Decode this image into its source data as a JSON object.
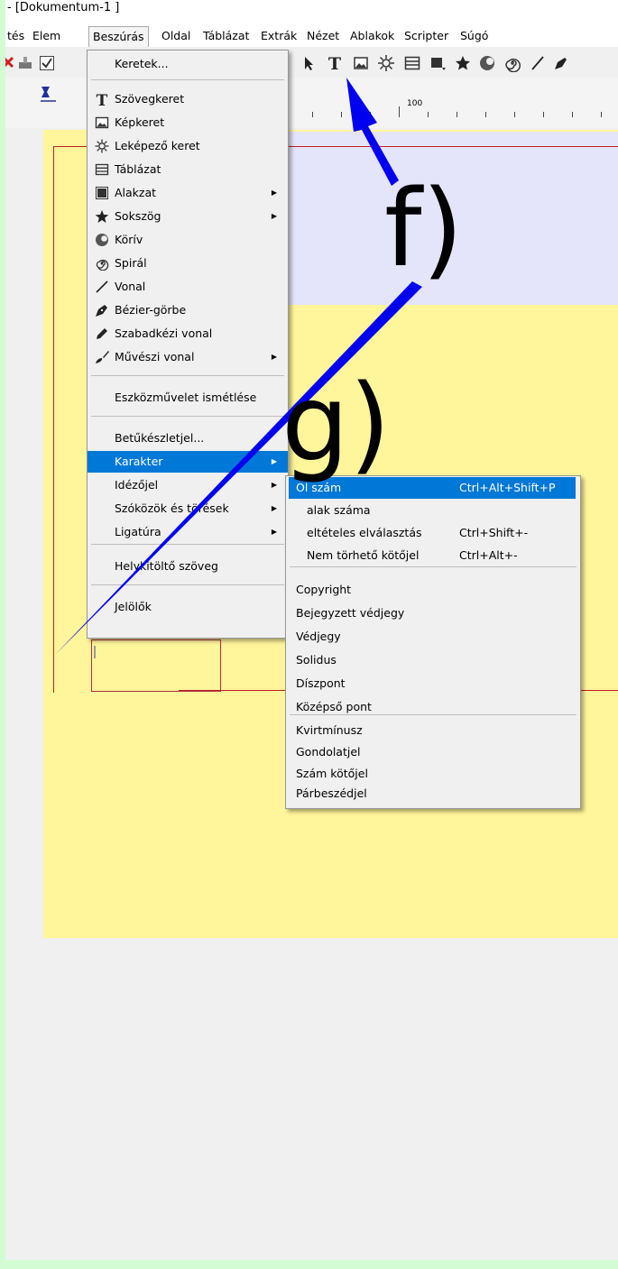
{
  "window": {
    "title": "- [Dokumentum-1 ]"
  },
  "menubar": {
    "items": [
      "tés",
      "Elem",
      "Beszúrás",
      "Oldal",
      "Táblázat",
      "Extrák",
      "Nézet",
      "Ablakok",
      "Scripter",
      "Súgó"
    ]
  },
  "ruler": {
    "mark": "100"
  },
  "insert_menu": {
    "items": [
      {
        "label": "Keretek...",
        "icon": "",
        "submenu": false
      },
      {
        "label": "Szövegkeret",
        "icon": "text-frame-icon",
        "submenu": false
      },
      {
        "label": "Képkeret",
        "icon": "image-frame-icon",
        "submenu": false
      },
      {
        "label": "Leképező keret",
        "icon": "render-frame-icon",
        "submenu": false
      },
      {
        "label": "Táblázat",
        "icon": "table-icon",
        "submenu": false
      },
      {
        "label": "Alakzat",
        "icon": "shape-icon",
        "submenu": true
      },
      {
        "label": "Sokszög",
        "icon": "star-icon",
        "submenu": true
      },
      {
        "label": "Körív",
        "icon": "arc-icon",
        "submenu": false
      },
      {
        "label": "Spirál",
        "icon": "spiral-icon",
        "submenu": false
      },
      {
        "label": "Vonal",
        "icon": "line-icon",
        "submenu": false
      },
      {
        "label": "Bézier-görbe",
        "icon": "bezier-pen-icon",
        "submenu": false
      },
      {
        "label": "Szabadkézi vonal",
        "icon": "pencil-icon",
        "submenu": false
      },
      {
        "label": "Művészi vonal",
        "icon": "brush-icon",
        "submenu": true
      },
      {
        "label": "Eszközművelet ismétlése",
        "icon": "",
        "submenu": false
      },
      {
        "label": "Betűkészletjel...",
        "icon": "",
        "submenu": false
      },
      {
        "label": "Karakter",
        "icon": "",
        "submenu": true,
        "highlighted": true
      },
      {
        "label": "Idézőjel",
        "icon": "",
        "submenu": true
      },
      {
        "label": "Szóközök és törések",
        "icon": "",
        "submenu": true
      },
      {
        "label": "Ligatúra",
        "icon": "",
        "submenu": true
      },
      {
        "label": "Helykitöltő szöveg",
        "icon": "",
        "submenu": false
      },
      {
        "label": "Jelölők",
        "icon": "",
        "submenu": false
      }
    ]
  },
  "character_menu": {
    "items": [
      {
        "label": "Ol szám",
        "shortcut": "Ctrl+Alt+Shift+P",
        "highlighted": true
      },
      {
        "label": "alak száma",
        "shortcut": ""
      },
      {
        "label": "eltételes elválasztás",
        "shortcut": "Ctrl+Shift+-"
      },
      {
        "label": "Nem törhető kötőjel",
        "shortcut": "Ctrl+Alt+-"
      },
      {
        "label": "Copyright",
        "shortcut": ""
      },
      {
        "label": "Bejegyzett védjegy",
        "shortcut": ""
      },
      {
        "label": "Védjegy",
        "shortcut": ""
      },
      {
        "label": "Solidus",
        "shortcut": ""
      },
      {
        "label": "Díszpont",
        "shortcut": ""
      },
      {
        "label": "Középső pont",
        "shortcut": ""
      },
      {
        "label": "Kvirtmínusz",
        "shortcut": ""
      },
      {
        "label": "Gondolatjel",
        "shortcut": ""
      },
      {
        "label": "Szám kötőjel",
        "shortcut": ""
      },
      {
        "label": "Párbeszédjel",
        "shortcut": ""
      }
    ]
  },
  "annotations": {
    "f_label": "f)",
    "g_label": "g)"
  },
  "colors": {
    "arrow": "#0000f0",
    "highlight": "#0078d7",
    "page": "#fff59a",
    "margin": "#c0202a"
  }
}
